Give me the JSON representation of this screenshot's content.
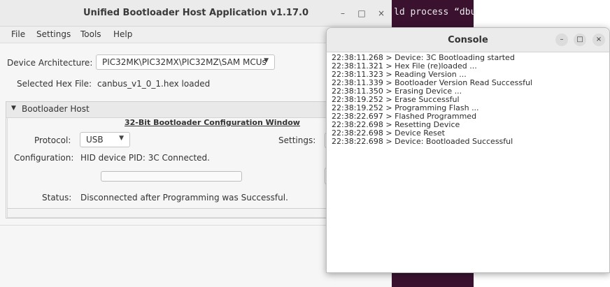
{
  "terminal": {
    "text": "ld process “dbu"
  },
  "main_window": {
    "title": "Unified Bootloader Host Application v1.17.0",
    "controls": {
      "minimize": "–",
      "maximize": "□",
      "close": "×"
    },
    "menu": [
      "File",
      "Settings",
      "Tools",
      "Help"
    ],
    "device_architecture": {
      "label": "Device Architecture:",
      "value": "PIC32MK\\PIC32MX\\PIC32MZ\\SAM MCUs"
    },
    "selected_hex": {
      "label": "Selected Hex File:",
      "value": "canbus_v1_0_1.hex loaded"
    },
    "bootloader_host": {
      "header": "Bootloader Host",
      "config_title": "32-Bit Bootloader Configuration Window",
      "protocol": {
        "label": "Protocol:",
        "value": "USB"
      },
      "settings_label": "Settings:",
      "configuration": {
        "label": "Configuration:",
        "value": "HID device PID: 3C Connected."
      },
      "progress": 0,
      "status": {
        "label": "Status:",
        "value": "Disconnected after Programming was Successful."
      }
    }
  },
  "console": {
    "title": "Console",
    "controls": {
      "minimize": "–",
      "maximize": "□",
      "close": "×"
    },
    "lines": [
      "22:38:11.268 > Device: 3C Bootloading started",
      "22:38:11.321 > Hex File (re)loaded ...",
      "22:38:11.323 > Reading Version ...",
      "22:38:11.339 > Bootloader Version Read Successful",
      "22:38:11.350 > Erasing Device ...",
      "22:38:19.252 > Erase Successful",
      "22:38:19.252 > Programming Flash ...",
      "22:38:22.697 > Flashed Programmed",
      "22:38:22.698 > Resetting Device",
      "22:38:22.698 > Device Reset",
      "22:38:22.698 > Device: Bootloaded Successful"
    ]
  }
}
